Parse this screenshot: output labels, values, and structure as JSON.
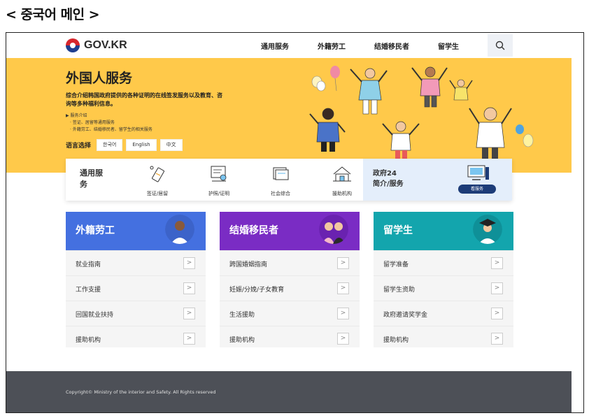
{
  "caption": "< 중국어 메인 >",
  "header": {
    "logo_text": "GOV.KR",
    "nav": [
      "通用服务",
      "外籍劳工",
      "结婚移民者",
      "留学生"
    ],
    "search_icon": "search-icon"
  },
  "banner": {
    "title": "外国人服务",
    "desc": "综合介绍韩国政府提供的各种证明的在线签发服务以及教育、咨询等多种福利信息。",
    "sub": [
      "▶ 服务介绍",
      "· 签证、居留等通用服务",
      "· 外籍劳工、结婚移民者、留学生的相关服务"
    ],
    "lang_label": "语言选择",
    "langs": [
      "한국어",
      "English",
      "中文"
    ],
    "bg_color": "#ffc94a"
  },
  "services": {
    "title": "通用服务",
    "items": [
      {
        "label": "签证/居留",
        "icon": "visa-icon"
      },
      {
        "label": "护照/证明",
        "icon": "passport-icon"
      },
      {
        "label": "社会综合",
        "icon": "folder-icon"
      },
      {
        "label": "援助机构",
        "icon": "building-icon"
      }
    ],
    "gov24": {
      "text1": "政府24",
      "text2": "简介/服务",
      "button": "看服务",
      "icon": "computer-icon"
    }
  },
  "cards": [
    {
      "title": "外籍劳工",
      "color": "#4470e0",
      "items": [
        "就业指南",
        "工作支援",
        "回国就业扶持",
        "援助机构"
      ]
    },
    {
      "title": "结婚移民者",
      "color": "#7a2cc4",
      "items": [
        "跨国婚姻指南",
        "妊娠/分娩/子女教育",
        "生活援助",
        "援助机构"
      ]
    },
    {
      "title": "留学生",
      "color": "#13a5ad",
      "items": [
        "留学准备",
        "留学生资助",
        "政府邀请奖学金",
        "援助机构"
      ]
    }
  ],
  "footer": {
    "copyright": "Copyright© Ministry of the interior and Safety. All Rights reserved"
  }
}
